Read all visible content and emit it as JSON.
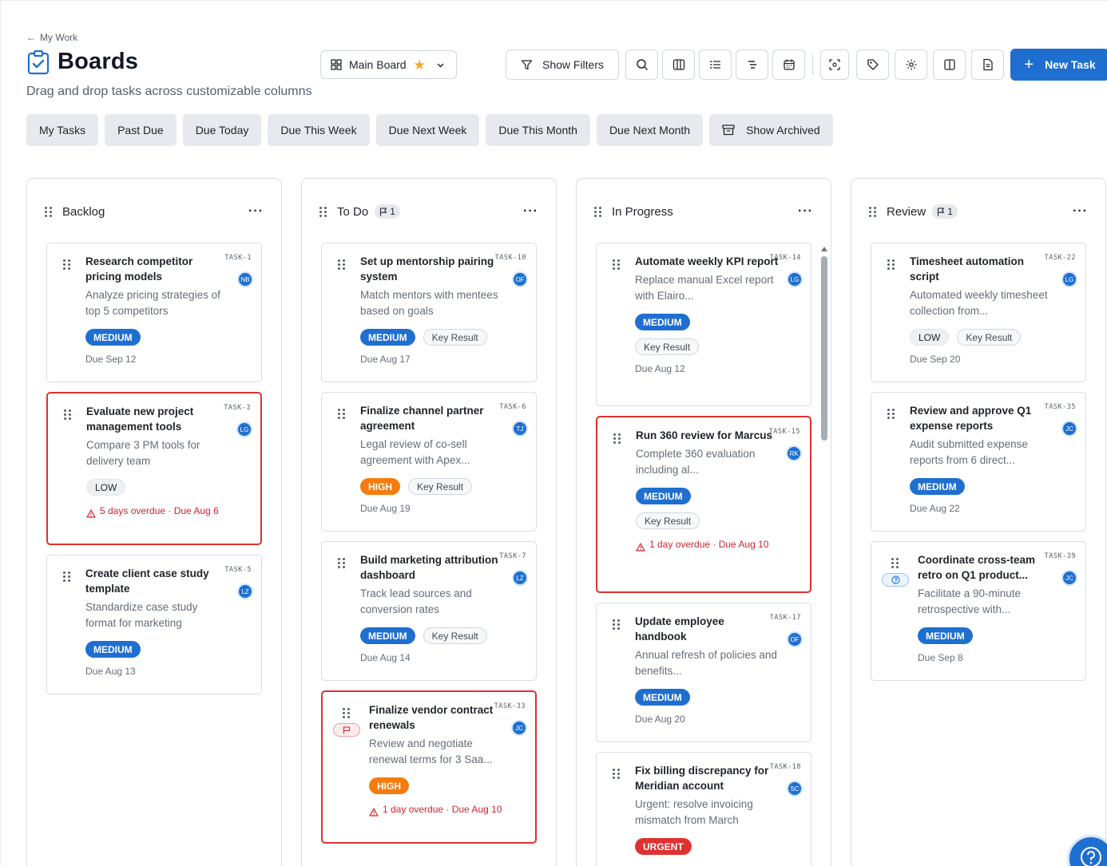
{
  "breadcrumb": {
    "label": "My Work"
  },
  "header": {
    "title": "Boards",
    "subtitle": "Drag and drop tasks across customizable columns",
    "board_name": "Main Board"
  },
  "toolbar": {
    "show_filters_label": "Show Filters",
    "new_task_label": "New Task"
  },
  "filters": [
    {
      "label": "My Tasks"
    },
    {
      "label": "Past Due"
    },
    {
      "label": "Due Today"
    },
    {
      "label": "Due This Week"
    },
    {
      "label": "Due Next Week"
    },
    {
      "label": "Due This Month"
    },
    {
      "label": "Due Next Month"
    },
    {
      "label": "Show Archived"
    }
  ],
  "columns": [
    {
      "name": "Backlog",
      "cards": [
        {
          "id": "TASK-1",
          "title": "Research competitor pricing models",
          "desc": "Analyze pricing strategies of top 5 competitors",
          "avatar": "NB",
          "priority": "MEDIUM",
          "due": "Due Sep 12"
        },
        {
          "id": "TASK-3",
          "title": "Evaluate new project management tools",
          "desc": "Compare 3 PM tools for delivery team",
          "avatar": "LG",
          "priority": "LOW",
          "overdue": "5 days overdue · Due Aug 6"
        },
        {
          "id": "TASK-5",
          "title": "Create client case study template",
          "desc": "Standardize case study format for marketing",
          "avatar": "LZ",
          "priority": "MEDIUM",
          "due": "Due Aug 13"
        }
      ]
    },
    {
      "name": "To Do",
      "badge": "1",
      "cards": [
        {
          "id": "TASK-10",
          "title": "Set up mentorship pairing system",
          "desc": "Match mentors with mentees based on goals",
          "avatar": "OF",
          "priority": "MEDIUM",
          "tag": "Key Result",
          "due": "Due Aug 17"
        },
        {
          "id": "TASK-6",
          "title": "Finalize channel partner agreement",
          "desc": "Legal review of co-sell agreement with Apex...",
          "avatar": "TJ",
          "priority": "HIGH",
          "tag": "Key Result",
          "due": "Due Aug 19"
        },
        {
          "id": "TASK-7",
          "title": "Build marketing attribution dashboard",
          "desc": "Track lead sources and conversion rates",
          "avatar": "LZ",
          "priority": "MEDIUM",
          "tag": "Key Result",
          "due": "Due Aug 14"
        },
        {
          "id": "TASK-33",
          "title": "Finalize vendor contract renewals",
          "desc": "Review and negotiate renewal terms for 3 Saa...",
          "avatar": "JC",
          "priority": "HIGH",
          "overdue": "1 day overdue · Due Aug 10"
        }
      ]
    },
    {
      "name": "In Progress",
      "cards": [
        {
          "id": "TASK-14",
          "title": "Automate weekly KPI report",
          "desc": "Replace manual Excel report with Elairo...",
          "avatar": "LG",
          "priority": "MEDIUM",
          "tag": "Key Result",
          "due": "Due Aug 12"
        },
        {
          "id": "TASK-15",
          "title": "Run 360 review for Marcus",
          "desc": "Complete 360 evaluation including al...",
          "avatar": "RK",
          "priority": "MEDIUM",
          "tag": "Key Result",
          "overdue": "1 day overdue · Due Aug 10"
        },
        {
          "id": "TASK-17",
          "title": "Update employee handbook",
          "desc": "Annual refresh of policies and benefits...",
          "avatar": "OF",
          "priority": "MEDIUM",
          "due": "Due Aug 20"
        },
        {
          "id": "TASK-18",
          "title": "Fix billing discrepancy for Meridian account",
          "desc": "Urgent: resolve invoicing mismatch from March",
          "avatar": "SC",
          "priority": "URGENT"
        }
      ]
    },
    {
      "name": "Review",
      "badge": "1",
      "cards": [
        {
          "id": "TASK-22",
          "title": "Timesheet automation script",
          "desc": "Automated weekly timesheet collection from...",
          "avatar": "LG",
          "priority": "LOW",
          "tag": "Key Result",
          "due": "Due Sep 20"
        },
        {
          "id": "TASK-35",
          "title": "Review and approve Q1 expense reports",
          "desc": "Audit submitted expense reports from 6 direct...",
          "avatar": "JC",
          "priority": "MEDIUM",
          "due": "Due Aug 22"
        },
        {
          "id": "TASK-39",
          "title": "Coordinate cross-team retro on Q1 product...",
          "desc": "Facilitate a 90-minute retrospective with...",
          "avatar": "JC",
          "priority": "MEDIUM",
          "due": "Due Sep 8"
        }
      ]
    }
  ],
  "colors": {
    "accent": "#1f6fd0",
    "high": "#f57c0c",
    "urgent": "#e03131",
    "overdue": "#d1242f"
  }
}
